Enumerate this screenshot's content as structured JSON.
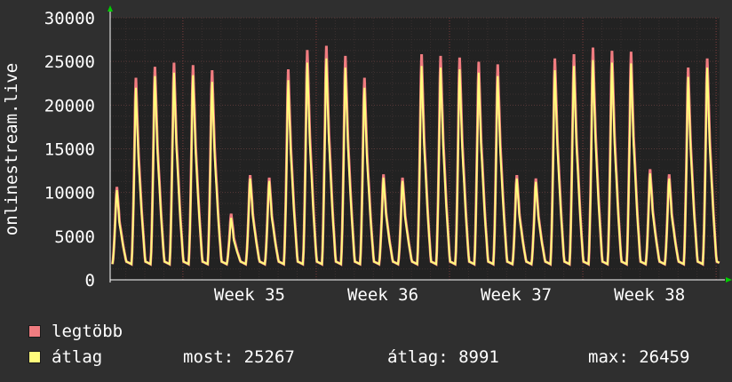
{
  "chart_data": {
    "type": "area",
    "ylabel": "onlinestream.live",
    "ylim": [
      0,
      30000
    ],
    "y_ticks": [
      "0",
      "5000",
      "10000",
      "15000",
      "20000",
      "25000",
      "30000"
    ],
    "x_tick_labels": [
      "Week 35",
      "Week 36",
      "Week 37",
      "Week 38"
    ],
    "grid": true,
    "daily_peaks": {
      "legtobb": [
        11000,
        24000,
        25300,
        25800,
        25500,
        24900,
        7800,
        12400,
        12100,
        25000,
        27300,
        27800,
        26600,
        24000,
        12500,
        12100,
        26800,
        26600,
        26400,
        25900,
        25600,
        12400,
        12000,
        26300,
        26800,
        27600,
        27200,
        27100,
        13100,
        12500,
        25200,
        26300
      ],
      "atlag": [
        10600,
        22800,
        24200,
        24600,
        24300,
        23500,
        7300,
        12000,
        11700,
        23700,
        25800,
        26300,
        25200,
        22800,
        12100,
        11700,
        25400,
        25200,
        25000,
        24600,
        24200,
        12000,
        11600,
        24900,
        25400,
        26100,
        25800,
        25700,
        12600,
        12000,
        24100,
        25200
      ]
    },
    "series": [
      {
        "name": "legtöbb",
        "color": "#f07c80"
      },
      {
        "name": "átlag",
        "color": "#fffc7c"
      }
    ],
    "legend_position": "bottom-left"
  },
  "legend": {
    "max_label": "legtöbb",
    "avg_label": "átlag",
    "current": "most: 25267",
    "average": "átlag: 8991",
    "maximum": "max: 26459"
  },
  "colors": {
    "background": "#2f2f2f",
    "plot_background": "#222222",
    "legtobb": "#f07c80",
    "atlag": "#fffc7c",
    "grid": "#5a3a3a",
    "axis_arrow": "#00cc00"
  }
}
